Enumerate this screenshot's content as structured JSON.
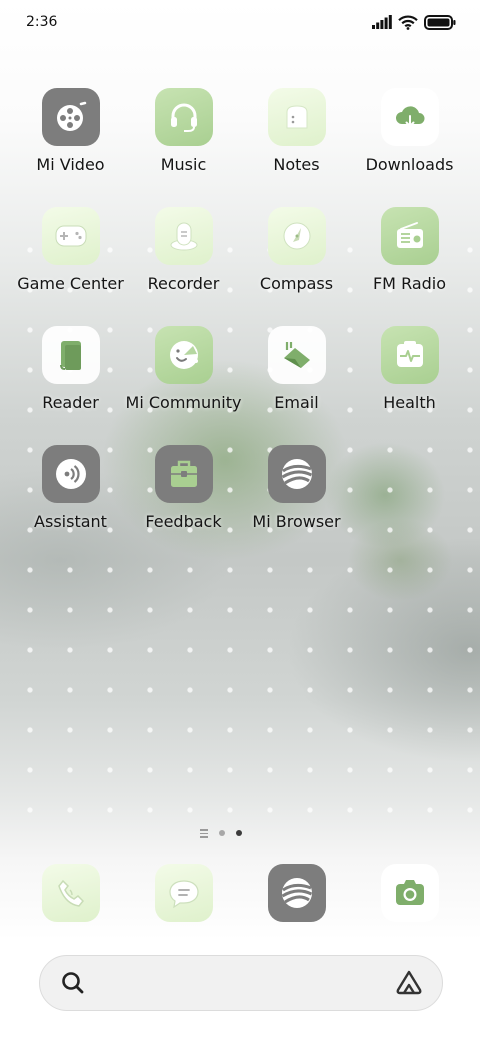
{
  "status_bar": {
    "time": "2:36"
  },
  "apps": [
    {
      "label": "Mi Video",
      "icon": "video-reel-icon"
    },
    {
      "label": "Music",
      "icon": "headphones-icon"
    },
    {
      "label": "Notes",
      "icon": "notes-icon"
    },
    {
      "label": "Downloads",
      "icon": "cloud-download-icon"
    },
    {
      "label": "Game Center",
      "icon": "gamepad-icon"
    },
    {
      "label": "Recorder",
      "icon": "microphone-icon"
    },
    {
      "label": "Compass",
      "icon": "compass-icon"
    },
    {
      "label": "FM Radio",
      "icon": "radio-icon"
    },
    {
      "label": "Reader",
      "icon": "book-icon"
    },
    {
      "label": "Mi Community",
      "icon": "community-icon"
    },
    {
      "label": "Email",
      "icon": "mail-icon"
    },
    {
      "label": "Health",
      "icon": "heart-rate-icon"
    },
    {
      "label": "Assistant",
      "icon": "assistant-icon"
    },
    {
      "label": "Feedback",
      "icon": "toolbox-icon"
    },
    {
      "label": "Mi Browser",
      "icon": "globe-icon"
    }
  ],
  "dock": [
    {
      "icon": "phone-icon"
    },
    {
      "icon": "message-icon"
    },
    {
      "icon": "browser-icon"
    },
    {
      "icon": "camera-icon"
    }
  ],
  "page_indicator": {
    "pages": 2,
    "active_page": 2
  },
  "search_bar": {
    "left_icon": "search-icon",
    "right_icon": "assistant-logo-icon"
  },
  "colors": {
    "gray_tile": "#7d7d7d",
    "green_tile": "#a9cf91",
    "pale_tile": "#e6f4d6",
    "glyph_green": "#7fae6b"
  }
}
